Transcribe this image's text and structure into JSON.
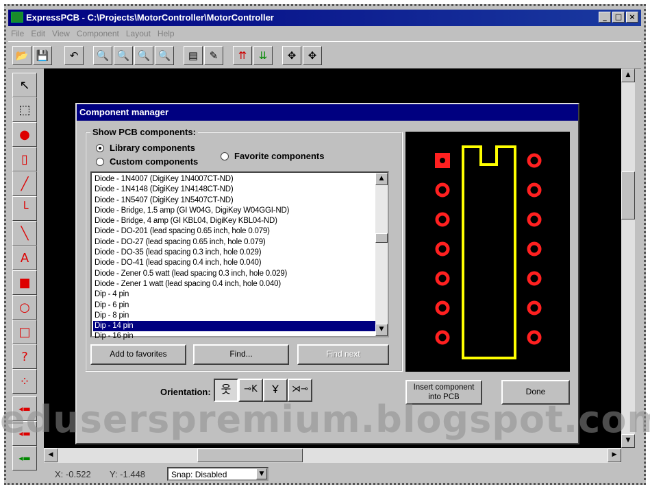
{
  "window": {
    "title": "ExpressPCB - C:\\Projects\\MotorController\\MotorController",
    "minimize": "_",
    "maximize": "□",
    "close": "×"
  },
  "menu": [
    "File",
    "Edit",
    "View",
    "Component",
    "Layout",
    "Help"
  ],
  "toolbar_icons": [
    "open-icon",
    "save-icon",
    "undo-icon",
    "zoom-in-icon",
    "zoom-out-icon",
    "zoom-fit-icon",
    "zoom-icon",
    "properties-icon",
    "component-icon",
    "layer-top-icon",
    "layer-bottom-icon",
    "move-icon",
    "move-all-icon"
  ],
  "left_tools": [
    "select-icon",
    "component-select-icon",
    "pad-icon",
    "component-icon",
    "trace-icon",
    "corner-icon",
    "line-icon",
    "text-icon",
    "shape-icon",
    "circle-icon",
    "rectangle-icon",
    "query-icon",
    "netlist-icon",
    "layer-1-icon",
    "layer-2-icon",
    "layer-3-icon",
    "ratsnest-icon"
  ],
  "dialog": {
    "title": "Component manager",
    "group_label": "Show PCB components:",
    "radio_library": "Library components",
    "radio_custom": "Custom components",
    "radio_favorite": "Favorite components",
    "selected_radio": "library",
    "components": [
      "Diode - 1N4007  (DigiKey 1N4007CT-ND)",
      "Diode - 1N4148  (DigiKey 1N4148CT-ND)",
      "Diode - 1N5407  (DigiKey 1N5407CT-ND)",
      "Diode - Bridge, 1.5 amp  (GI W04G, DigiKey W04GGI-ND)",
      "Diode - Bridge, 4 amp  (GI KBL04, DigiKey KBL04-ND)",
      "Diode - DO-201  (lead spacing 0.65 inch, hole 0.079)",
      "Diode - DO-27  (lead spacing 0.65 inch, hole 0.079)",
      "Diode - DO-35  (lead spacing 0.3 inch, hole 0.029)",
      "Diode - DO-41  (lead spacing 0.4 inch, hole 0.040)",
      "Diode - Zener 0.5 watt  (lead spacing 0.3 inch, hole 0.029)",
      "Diode - Zener 1 watt  (lead spacing 0.4 inch, hole 0.040)",
      "Dip -  4 pin",
      "Dip -  6 pin",
      "Dip -  8 pin",
      "Dip - 14 pin",
      "Dip - 16 pin"
    ],
    "selected_component": "Dip - 14 pin",
    "btn_add_favorites": "Add to favorites",
    "btn_find": "Find...",
    "btn_find_next": "Find next",
    "orientation_label": "Orientation:",
    "orientation_icons": [
      "orient-up-icon",
      "orient-left-icon",
      "orient-down-icon",
      "orient-right-icon"
    ],
    "btn_insert": "Insert component into PCB",
    "btn_done": "Done",
    "preview": {
      "pins_per_side": 7,
      "pad_color": "#ff2020",
      "outline_color": "#ffff00"
    }
  },
  "status": {
    "x": "X: -0.522",
    "y": "Y: -1.448",
    "snap": "Snap:  Disabled"
  },
  "watermark": "eduserspremium.blogspot.com",
  "colors": {
    "title_bar": "#000080",
    "workspace": "#000000",
    "selection": "#000080"
  }
}
